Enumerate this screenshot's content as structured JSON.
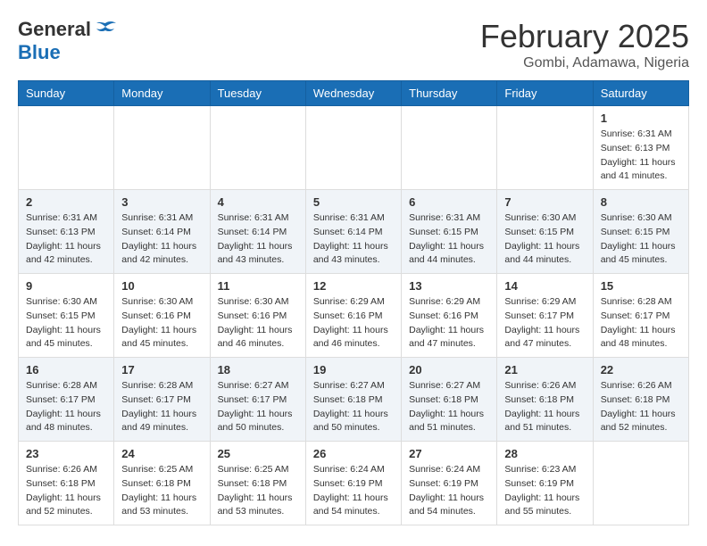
{
  "header": {
    "logo_general": "General",
    "logo_blue": "Blue",
    "month_title": "February 2025",
    "location": "Gombi, Adamawa, Nigeria"
  },
  "weekdays": [
    "Sunday",
    "Monday",
    "Tuesday",
    "Wednesday",
    "Thursday",
    "Friday",
    "Saturday"
  ],
  "weeks": [
    [
      {
        "day": "",
        "sunrise": "",
        "sunset": "",
        "daylight": ""
      },
      {
        "day": "",
        "sunrise": "",
        "sunset": "",
        "daylight": ""
      },
      {
        "day": "",
        "sunrise": "",
        "sunset": "",
        "daylight": ""
      },
      {
        "day": "",
        "sunrise": "",
        "sunset": "",
        "daylight": ""
      },
      {
        "day": "",
        "sunrise": "",
        "sunset": "",
        "daylight": ""
      },
      {
        "day": "",
        "sunrise": "",
        "sunset": "",
        "daylight": ""
      },
      {
        "day": "1",
        "sunrise": "Sunrise: 6:31 AM",
        "sunset": "Sunset: 6:13 PM",
        "daylight": "Daylight: 11 hours and 41 minutes."
      }
    ],
    [
      {
        "day": "2",
        "sunrise": "Sunrise: 6:31 AM",
        "sunset": "Sunset: 6:13 PM",
        "daylight": "Daylight: 11 hours and 42 minutes."
      },
      {
        "day": "3",
        "sunrise": "Sunrise: 6:31 AM",
        "sunset": "Sunset: 6:14 PM",
        "daylight": "Daylight: 11 hours and 42 minutes."
      },
      {
        "day": "4",
        "sunrise": "Sunrise: 6:31 AM",
        "sunset": "Sunset: 6:14 PM",
        "daylight": "Daylight: 11 hours and 43 minutes."
      },
      {
        "day": "5",
        "sunrise": "Sunrise: 6:31 AM",
        "sunset": "Sunset: 6:14 PM",
        "daylight": "Daylight: 11 hours and 43 minutes."
      },
      {
        "day": "6",
        "sunrise": "Sunrise: 6:31 AM",
        "sunset": "Sunset: 6:15 PM",
        "daylight": "Daylight: 11 hours and 44 minutes."
      },
      {
        "day": "7",
        "sunrise": "Sunrise: 6:30 AM",
        "sunset": "Sunset: 6:15 PM",
        "daylight": "Daylight: 11 hours and 44 minutes."
      },
      {
        "day": "8",
        "sunrise": "Sunrise: 6:30 AM",
        "sunset": "Sunset: 6:15 PM",
        "daylight": "Daylight: 11 hours and 45 minutes."
      }
    ],
    [
      {
        "day": "9",
        "sunrise": "Sunrise: 6:30 AM",
        "sunset": "Sunset: 6:15 PM",
        "daylight": "Daylight: 11 hours and 45 minutes."
      },
      {
        "day": "10",
        "sunrise": "Sunrise: 6:30 AM",
        "sunset": "Sunset: 6:16 PM",
        "daylight": "Daylight: 11 hours and 45 minutes."
      },
      {
        "day": "11",
        "sunrise": "Sunrise: 6:30 AM",
        "sunset": "Sunset: 6:16 PM",
        "daylight": "Daylight: 11 hours and 46 minutes."
      },
      {
        "day": "12",
        "sunrise": "Sunrise: 6:29 AM",
        "sunset": "Sunset: 6:16 PM",
        "daylight": "Daylight: 11 hours and 46 minutes."
      },
      {
        "day": "13",
        "sunrise": "Sunrise: 6:29 AM",
        "sunset": "Sunset: 6:16 PM",
        "daylight": "Daylight: 11 hours and 47 minutes."
      },
      {
        "day": "14",
        "sunrise": "Sunrise: 6:29 AM",
        "sunset": "Sunset: 6:17 PM",
        "daylight": "Daylight: 11 hours and 47 minutes."
      },
      {
        "day": "15",
        "sunrise": "Sunrise: 6:28 AM",
        "sunset": "Sunset: 6:17 PM",
        "daylight": "Daylight: 11 hours and 48 minutes."
      }
    ],
    [
      {
        "day": "16",
        "sunrise": "Sunrise: 6:28 AM",
        "sunset": "Sunset: 6:17 PM",
        "daylight": "Daylight: 11 hours and 48 minutes."
      },
      {
        "day": "17",
        "sunrise": "Sunrise: 6:28 AM",
        "sunset": "Sunset: 6:17 PM",
        "daylight": "Daylight: 11 hours and 49 minutes."
      },
      {
        "day": "18",
        "sunrise": "Sunrise: 6:27 AM",
        "sunset": "Sunset: 6:17 PM",
        "daylight": "Daylight: 11 hours and 50 minutes."
      },
      {
        "day": "19",
        "sunrise": "Sunrise: 6:27 AM",
        "sunset": "Sunset: 6:18 PM",
        "daylight": "Daylight: 11 hours and 50 minutes."
      },
      {
        "day": "20",
        "sunrise": "Sunrise: 6:27 AM",
        "sunset": "Sunset: 6:18 PM",
        "daylight": "Daylight: 11 hours and 51 minutes."
      },
      {
        "day": "21",
        "sunrise": "Sunrise: 6:26 AM",
        "sunset": "Sunset: 6:18 PM",
        "daylight": "Daylight: 11 hours and 51 minutes."
      },
      {
        "day": "22",
        "sunrise": "Sunrise: 6:26 AM",
        "sunset": "Sunset: 6:18 PM",
        "daylight": "Daylight: 11 hours and 52 minutes."
      }
    ],
    [
      {
        "day": "23",
        "sunrise": "Sunrise: 6:26 AM",
        "sunset": "Sunset: 6:18 PM",
        "daylight": "Daylight: 11 hours and 52 minutes."
      },
      {
        "day": "24",
        "sunrise": "Sunrise: 6:25 AM",
        "sunset": "Sunset: 6:18 PM",
        "daylight": "Daylight: 11 hours and 53 minutes."
      },
      {
        "day": "25",
        "sunrise": "Sunrise: 6:25 AM",
        "sunset": "Sunset: 6:18 PM",
        "daylight": "Daylight: 11 hours and 53 minutes."
      },
      {
        "day": "26",
        "sunrise": "Sunrise: 6:24 AM",
        "sunset": "Sunset: 6:19 PM",
        "daylight": "Daylight: 11 hours and 54 minutes."
      },
      {
        "day": "27",
        "sunrise": "Sunrise: 6:24 AM",
        "sunset": "Sunset: 6:19 PM",
        "daylight": "Daylight: 11 hours and 54 minutes."
      },
      {
        "day": "28",
        "sunrise": "Sunrise: 6:23 AM",
        "sunset": "Sunset: 6:19 PM",
        "daylight": "Daylight: 11 hours and 55 minutes."
      },
      {
        "day": "",
        "sunrise": "",
        "sunset": "",
        "daylight": ""
      }
    ]
  ]
}
